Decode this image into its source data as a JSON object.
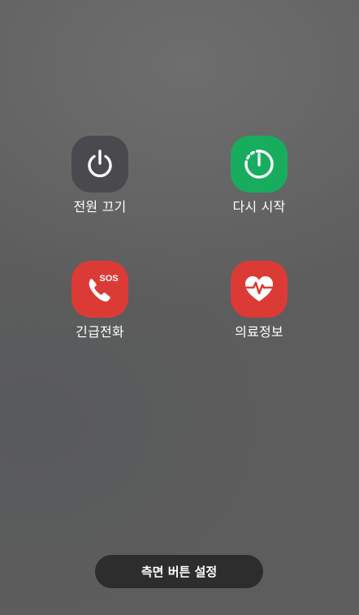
{
  "menu": {
    "items": [
      {
        "id": "power_off",
        "label": "전원 끄기",
        "icon": "power-icon",
        "color": "#4a4a4e"
      },
      {
        "id": "restart",
        "label": "다시 시작",
        "icon": "restart-icon",
        "color": "#17ac5e"
      },
      {
        "id": "emergency_call",
        "label": "긴급전화",
        "icon": "sos-phone-icon",
        "icon_text": "SOS",
        "color": "#dc3b35"
      },
      {
        "id": "medical_info",
        "label": "의료정보",
        "icon": "medical-heart-icon",
        "color": "#dc3b35"
      }
    ]
  },
  "side_button": {
    "label": "측면 버튼 설정",
    "color": "#2d2d2e"
  }
}
